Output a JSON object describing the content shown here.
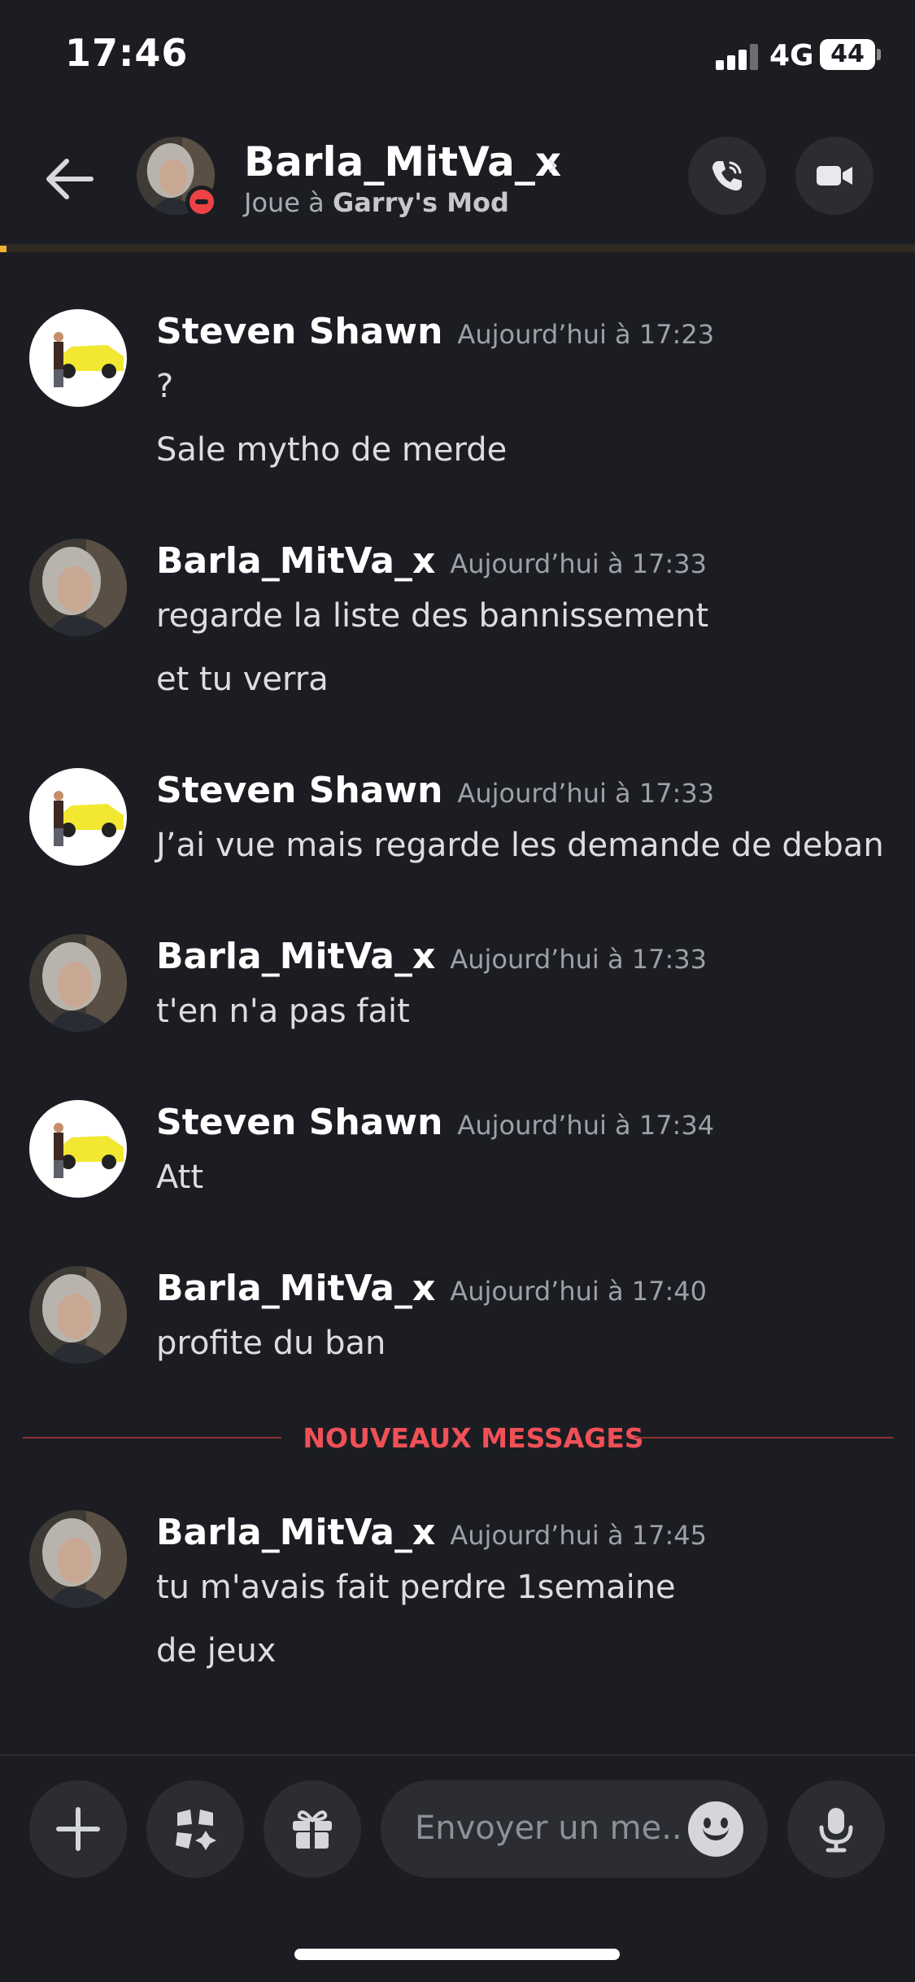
{
  "status_bar": {
    "time": "17:46",
    "network": "4G",
    "battery": "44"
  },
  "header": {
    "title": "Barla_MitVa_x",
    "status_prefix": "Joue à",
    "status_game": "Garry's Mod",
    "presence": "do-not-disturb",
    "icons": [
      "back-arrow-icon",
      "chevron-right-icon",
      "phone-call-icon",
      "video-camera-icon"
    ]
  },
  "messages": [
    {
      "author": "Steven Shawn",
      "timestamp": "Aujourd’hui à 17:23",
      "lines": [
        "?",
        "Sale mytho de merde"
      ],
      "avatar": "car-avatar"
    },
    {
      "author": "Barla_MitVa_x",
      "timestamp": "Aujourd’hui à 17:33",
      "lines": [
        "regarde la liste des bannissement",
        "et tu verra"
      ],
      "avatar": "portrait-avatar"
    },
    {
      "author": "Steven Shawn",
      "timestamp": "Aujourd’hui à 17:33",
      "lines": [
        "J’ai vue mais regarde les demande de deban"
      ],
      "avatar": "car-avatar"
    },
    {
      "author": "Barla_MitVa_x",
      "timestamp": "Aujourd’hui à 17:33",
      "lines": [
        "t'en n'a pas fait"
      ],
      "avatar": "portrait-avatar"
    },
    {
      "author": "Steven Shawn",
      "timestamp": "Aujourd’hui à 17:34",
      "lines": [
        "Att"
      ],
      "avatar": "car-avatar"
    },
    {
      "author": "Barla_MitVa_x",
      "timestamp": "Aujourd’hui à 17:40",
      "lines": [
        "profite du ban"
      ],
      "avatar": "portrait-avatar"
    },
    {
      "author": "Barla_MitVa_x",
      "timestamp": "Aujourd’hui à 17:45",
      "lines": [
        "tu m'avais fait perdre 1semaine",
        "de jeux"
      ],
      "avatar": "portrait-avatar"
    }
  ],
  "new_messages_label": "NOUVEAUX MESSAGES",
  "composer": {
    "placeholder": "Envoyer un me..",
    "buttons": [
      "plus-icon",
      "apps-icon",
      "gift-icon",
      "emoji-icon",
      "microphone-icon"
    ]
  },
  "colors": {
    "background": "#1c1d22",
    "button_bg": "#2b2d33",
    "new_messages": "#f05057",
    "dnd": "#ed4245",
    "accent_bar": "#f0b232"
  }
}
